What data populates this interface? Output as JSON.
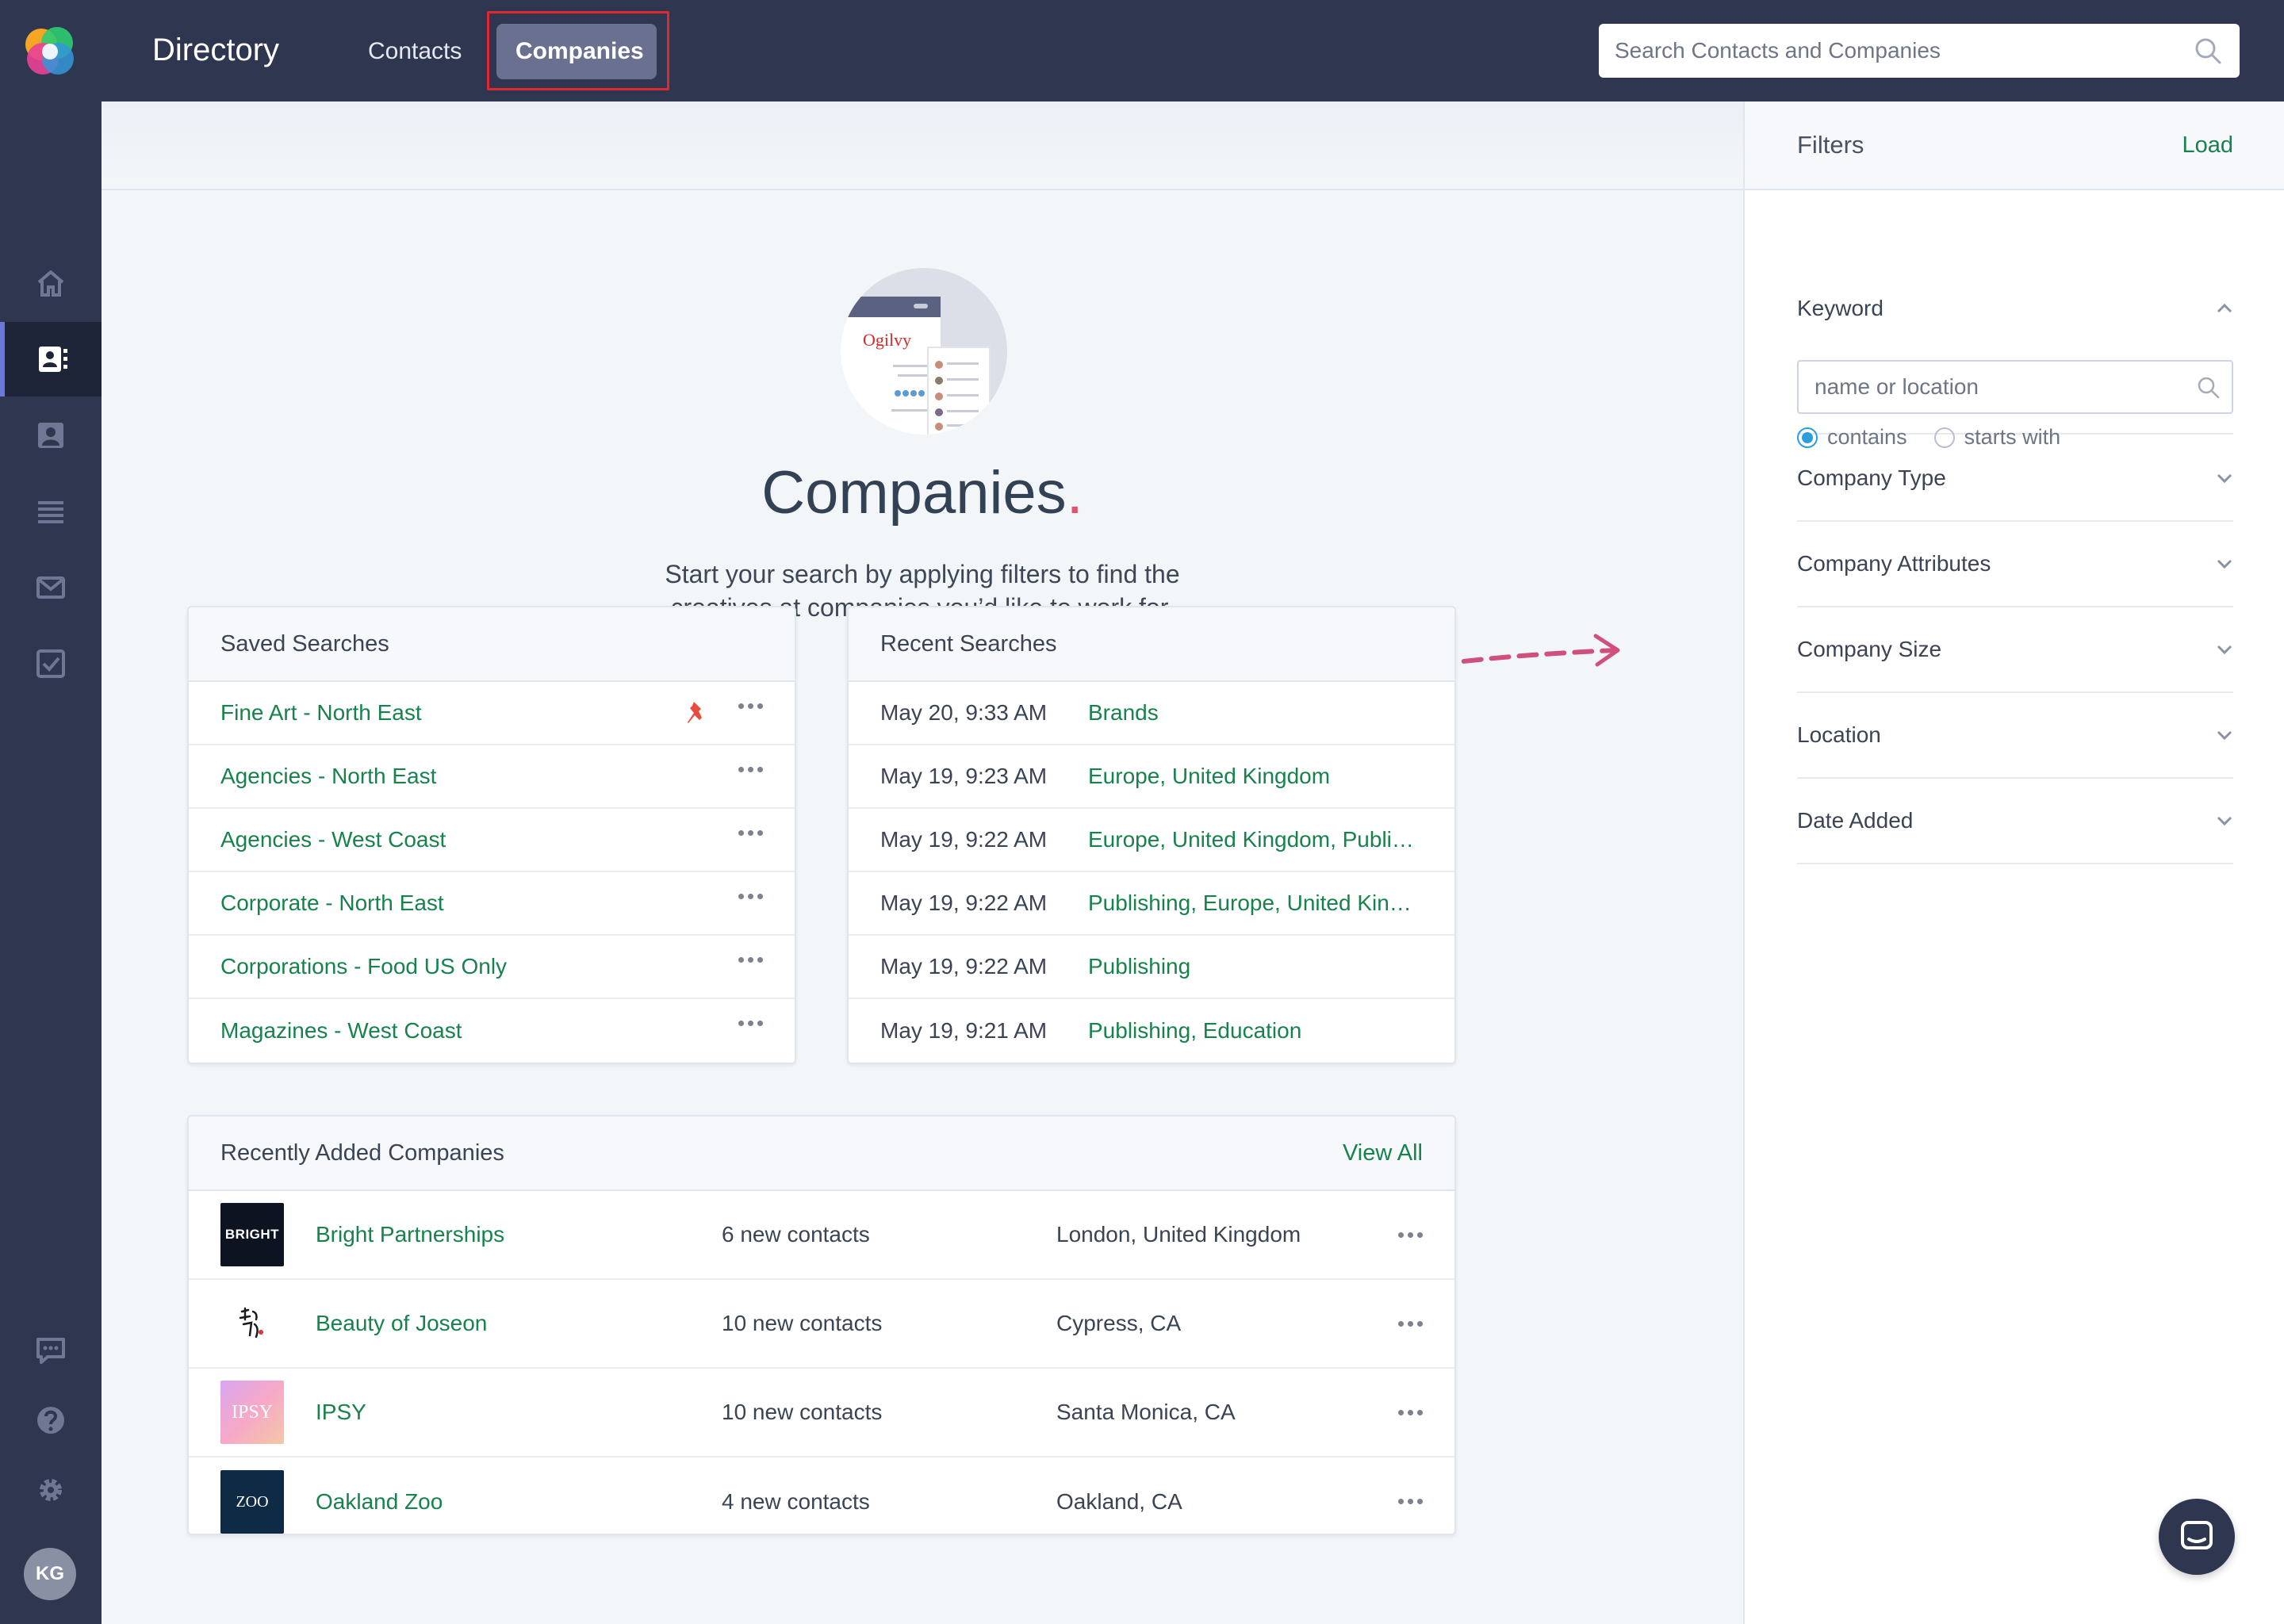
{
  "topbar": {
    "app_title": "Directory",
    "nav": [
      {
        "label": "Contacts"
      },
      {
        "label": "Companies"
      }
    ],
    "search_placeholder": "Search Contacts and Companies"
  },
  "sidebar": {
    "items": [
      "home-icon",
      "directory-icon",
      "contact-card-icon",
      "list-icon",
      "mail-icon",
      "tasks-icon"
    ],
    "bottom_items": [
      "feedback-icon",
      "help-icon",
      "settings-icon"
    ],
    "avatar_initials": "KG"
  },
  "hero": {
    "illustration_brand": "Ogilvy",
    "title": "Companies",
    "title_dot": ".",
    "subtitle_line1": "Start your search by applying filters to find the",
    "subtitle_line2": "creatives at companies you’d like to work for."
  },
  "saved_searches": {
    "title": "Saved Searches",
    "items": [
      {
        "label": "Fine Art - North East",
        "pinned": true
      },
      {
        "label": "Agencies - North East",
        "pinned": false
      },
      {
        "label": "Agencies - West Coast",
        "pinned": false
      },
      {
        "label": "Corporate - North East",
        "pinned": false
      },
      {
        "label": "Corporations - Food US Only",
        "pinned": false
      },
      {
        "label": "Magazines - West Coast",
        "pinned": false
      }
    ]
  },
  "recent_searches": {
    "title": "Recent Searches",
    "items": [
      {
        "when": "May 20, 9:33 AM",
        "what": "Brands"
      },
      {
        "when": "May 19, 9:23 AM",
        "what": "Europe, United Kingdom"
      },
      {
        "when": "May 19, 9:22 AM",
        "what": "Europe, United Kingdom, Publishing"
      },
      {
        "when": "May 19, 9:22 AM",
        "what": "Publishing, Europe, United Kingdom"
      },
      {
        "when": "May 19, 9:22 AM",
        "what": "Publishing"
      },
      {
        "when": "May 19, 9:21 AM",
        "what": "Publishing, Education"
      }
    ]
  },
  "recently_added": {
    "title": "Recently Added Companies",
    "view_all": "View All",
    "items": [
      {
        "logo_text": "BRIGHT",
        "name": "Bright Partnerships",
        "contacts": "6 new contacts",
        "location": "London, United Kingdom"
      },
      {
        "logo_text": "",
        "name": "Beauty of Joseon",
        "contacts": "10 new contacts",
        "location": "Cypress, CA"
      },
      {
        "logo_text": "IPSY",
        "name": "IPSY",
        "contacts": "10 new contacts",
        "location": "Santa Monica, CA"
      },
      {
        "logo_text": "ZOO",
        "name": "Oakland Zoo",
        "contacts": "4 new contacts",
        "location": "Oakland, CA"
      }
    ]
  },
  "filters": {
    "title": "Filters",
    "load": "Load",
    "keyword": {
      "label": "Keyword",
      "placeholder": "name or location",
      "options": [
        {
          "label": "contains",
          "selected": true
        },
        {
          "label": "starts with",
          "selected": false
        }
      ]
    },
    "sections": [
      {
        "label": "Company Type"
      },
      {
        "label": "Company Attributes"
      },
      {
        "label": "Company Size"
      },
      {
        "label": "Location"
      },
      {
        "label": "Date Added"
      }
    ]
  },
  "colors": {
    "topbar_bg": "#2f3650",
    "accent_green": "#17824b",
    "active_tab": "#6a7190",
    "highlight_red": "#e0282e",
    "radio_blue": "#2a9fd8"
  }
}
